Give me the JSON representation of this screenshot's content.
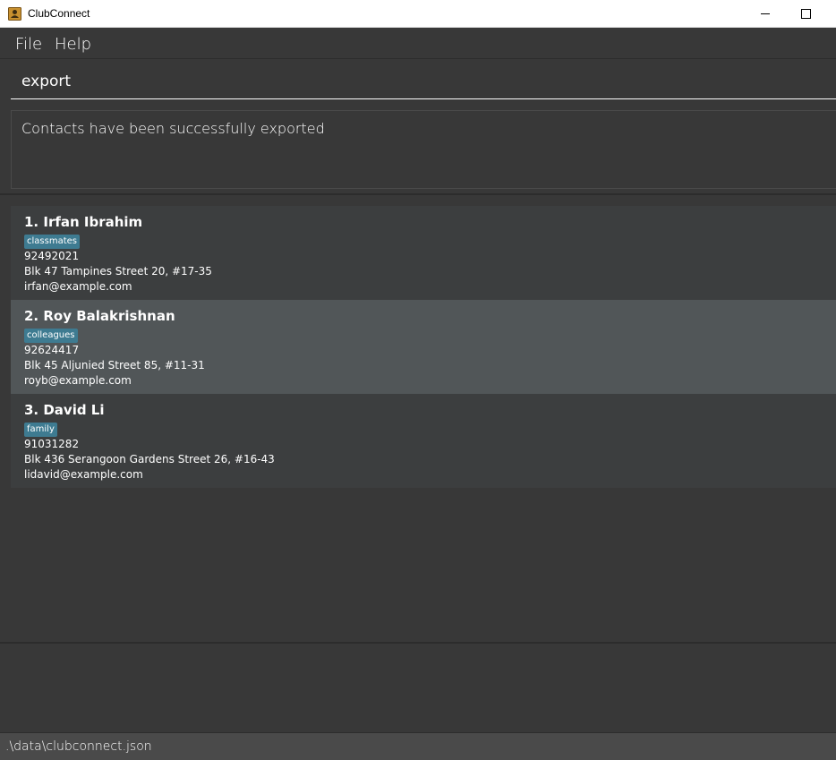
{
  "window": {
    "title": "ClubConnect",
    "icon": "address-book-icon"
  },
  "menu": {
    "file_label": "File",
    "help_label": "Help"
  },
  "command": {
    "value": "export"
  },
  "result": {
    "message": "Contacts have been successfully exported"
  },
  "persons": [
    {
      "name": "1. Irfan Ibrahim",
      "tag": "classmates",
      "phone": "92492021",
      "address": "Blk 47 Tampines Street 20, #17-35",
      "email": "irfan@example.com"
    },
    {
      "name": "2. Roy Balakrishnan",
      "tag": "colleagues",
      "phone": "92624417",
      "address": "Blk 45 Aljunied Street 85, #11-31",
      "email": "royb@example.com"
    },
    {
      "name": "3. David Li",
      "tag": "family",
      "phone": "91031282",
      "address": "Blk 436 Serangoon Gardens Street 26, #16-43",
      "email": "lidavid@example.com"
    }
  ],
  "status": {
    "file_path": ".\\data\\clubconnect.json"
  },
  "colors": {
    "background": "#383838",
    "card": "#3c3e3f",
    "card_selected": "#515658",
    "tag": "#3e7b91"
  }
}
